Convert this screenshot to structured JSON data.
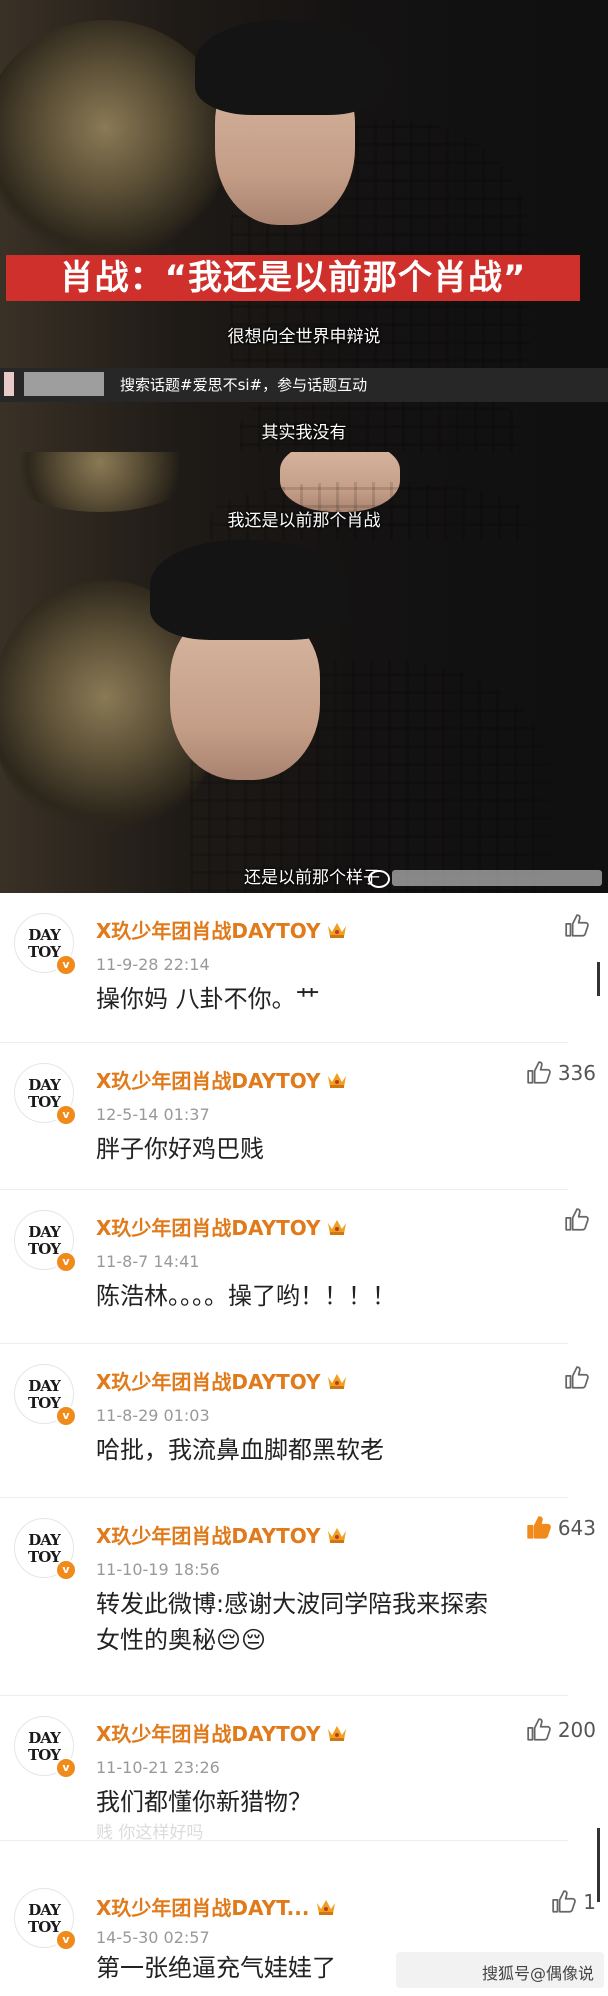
{
  "video": {
    "headline": "肖战：“我还是以前那个肖战”",
    "subtitles": [
      "很想向全世界申辩说",
      "其实我没有",
      "我还是以前那个肖战",
      "还是以前那个样子"
    ],
    "promo": "搜索话题#爱思不si#，参与话题互动"
  },
  "comments": [
    {
      "user": "X玖少年团肖战DAYTOY",
      "time": "11-9-28 22:14",
      "text": "操你妈  八卦不你。艹",
      "likes": "",
      "liked": false
    },
    {
      "user": "X玖少年团肖战DAYTOY",
      "time": "12-5-14 01:37",
      "text": "胖子你好鸡巴贱",
      "likes": "336",
      "liked": false
    },
    {
      "user": "X玖少年团肖战DAYTOY",
      "time": "11-8-7 14:41",
      "text": "陈浩林。。。。操了哟！！！！",
      "likes": "",
      "liked": false
    },
    {
      "user": "X玖少年团肖战DAYTOY",
      "time": "11-8-29 01:03",
      "text": "哈批，我流鼻血脚都黑软老",
      "likes": "",
      "liked": false
    },
    {
      "user": "X玖少年团肖战DAYTOY",
      "time": "11-10-19 18:56",
      "text": "转发此微博:感谢大波同学陪我来探索",
      "text2": "女性的奥秘😔😔",
      "likes": "643",
      "liked": true
    },
    {
      "user": "X玖少年团肖战DAYTOY",
      "time": "11-10-21 23:26",
      "text": "我们都懂你新猎物？",
      "likes": "200",
      "liked": false
    },
    {
      "user": "X玖少年团肖战DAYT...",
      "time": "14-5-30 02:57",
      "text": "第一张绝逼充气娃娃了",
      "likes": "1",
      "liked": false
    }
  ],
  "ghost_text": "贱 你这样好吗",
  "watermark": "搜狐号@偶像说",
  "avatar_text": [
    "DAY",
    "TOY"
  ],
  "colors": {
    "username": "#e07a1b",
    "liked": "#f08a1a",
    "headline_bg": "#d0302c"
  }
}
